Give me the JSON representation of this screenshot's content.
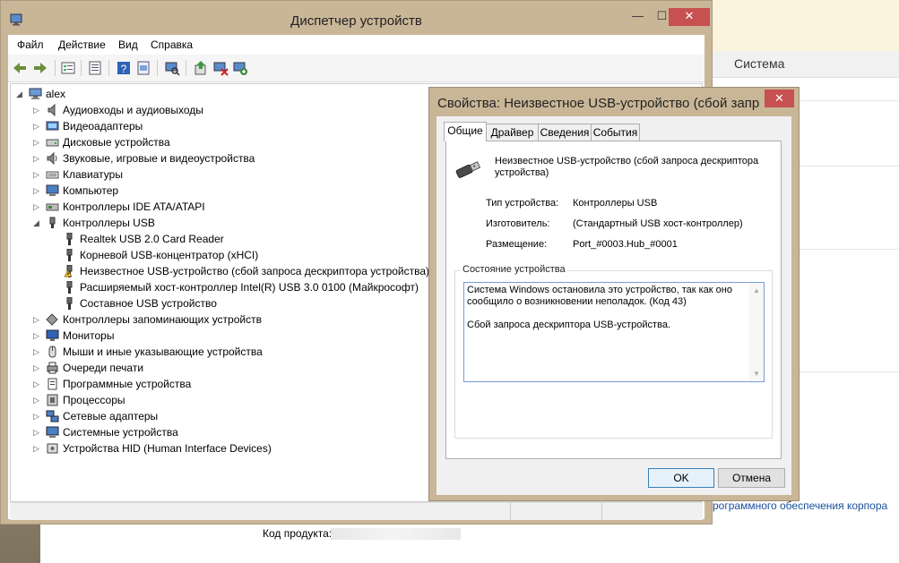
{
  "background_window": {
    "title": "Система",
    "link_text": "рограммного обеспечения корпора",
    "product_code_label": "Код продукта:"
  },
  "device_manager": {
    "title": "Диспетчер устройств",
    "window_buttons": {
      "minimize": "—",
      "maximize": "☐",
      "close": "✕"
    },
    "menu": [
      "Файл",
      "Действие",
      "Вид",
      "Справка"
    ],
    "toolbar_icons": [
      "back-icon",
      "forward-icon",
      "tree-view-icon",
      "properties-icon",
      "help-icon",
      "scan-hardware-icon",
      "update-driver-icon",
      "disable-device-icon",
      "uninstall-device-icon"
    ],
    "tree": {
      "root": "alex",
      "categories": [
        {
          "label": "Аудиовходы и аудиовыходы",
          "icon": "speaker-icon",
          "expanded": false
        },
        {
          "label": "Видеоадаптеры",
          "icon": "display-adapter-icon",
          "expanded": false
        },
        {
          "label": "Дисковые устройства",
          "icon": "disk-drive-icon",
          "expanded": false
        },
        {
          "label": "Звуковые, игровые и видеоустройства",
          "icon": "sound-icon",
          "expanded": false
        },
        {
          "label": "Клавиатуры",
          "icon": "keyboard-icon",
          "expanded": false
        },
        {
          "label": "Компьютер",
          "icon": "computer-icon",
          "expanded": false
        },
        {
          "label": "Контроллеры IDE ATA/ATAPI",
          "icon": "ide-controller-icon",
          "expanded": false
        },
        {
          "label": "Контроллеры USB",
          "icon": "usb-controller-icon",
          "expanded": true,
          "children": [
            {
              "label": "Realtek USB 2.0 Card Reader",
              "icon": "usb-plug-icon",
              "warning": false
            },
            {
              "label": "Корневой USB-концентратор (xHCI)",
              "icon": "usb-plug-icon",
              "warning": false
            },
            {
              "label": "Неизвестное USB-устройство (сбой запроса дескриптора устройства)",
              "icon": "usb-plug-warning-icon",
              "warning": true
            },
            {
              "label": "Расширяемый хост-контроллер Intel(R) USB 3.0 0100 (Майкрософт)",
              "icon": "usb-plug-icon",
              "warning": false
            },
            {
              "label": "Составное USB устройство",
              "icon": "usb-plug-icon",
              "warning": false
            }
          ]
        },
        {
          "label": "Контроллеры запоминающих устройств",
          "icon": "storage-controller-icon",
          "expanded": false
        },
        {
          "label": "Мониторы",
          "icon": "monitor-icon",
          "expanded": false
        },
        {
          "label": "Мыши и иные указывающие устройства",
          "icon": "mouse-icon",
          "expanded": false
        },
        {
          "label": "Очереди печати",
          "icon": "printer-icon",
          "expanded": false
        },
        {
          "label": "Программные устройства",
          "icon": "software-device-icon",
          "expanded": false
        },
        {
          "label": "Процессоры",
          "icon": "processor-icon",
          "expanded": false
        },
        {
          "label": "Сетевые адаптеры",
          "icon": "network-adapter-icon",
          "expanded": false
        },
        {
          "label": "Системные устройства",
          "icon": "system-device-icon",
          "expanded": false
        },
        {
          "label": "Устройства HID (Human Interface Devices)",
          "icon": "hid-icon",
          "expanded": false
        }
      ]
    }
  },
  "properties_dialog": {
    "title": "Свойства: Неизвестное USB-устройство (сбой запро...",
    "close": "✕",
    "tabs": [
      "Общие",
      "Драйвер",
      "Сведения",
      "События"
    ],
    "active_tab": "Общие",
    "device_name": "Неизвестное USB-устройство (сбой запроса дескриптора устройства)",
    "properties": [
      {
        "label": "Тип устройства:",
        "value": "Контроллеры USB"
      },
      {
        "label": "Изготовитель:",
        "value": "(Стандартный USB хост-контроллер)"
      },
      {
        "label": "Размещение:",
        "value": "Port_#0003.Hub_#0001"
      }
    ],
    "status_group_title": "Состояние устройства",
    "status_line1": "Система Windows остановила это устройство, так как оно",
    "status_line2": "сообщило о возникновении неполадок. (Код 43)",
    "status_line3": "Сбой запроса дескриптора USB-устройства.",
    "ok": "OK",
    "cancel": "Отмена"
  },
  "colors": {
    "window_frame": "#c9b697",
    "close_button": "#c75050",
    "accent_blue": "#3c7fb1"
  }
}
